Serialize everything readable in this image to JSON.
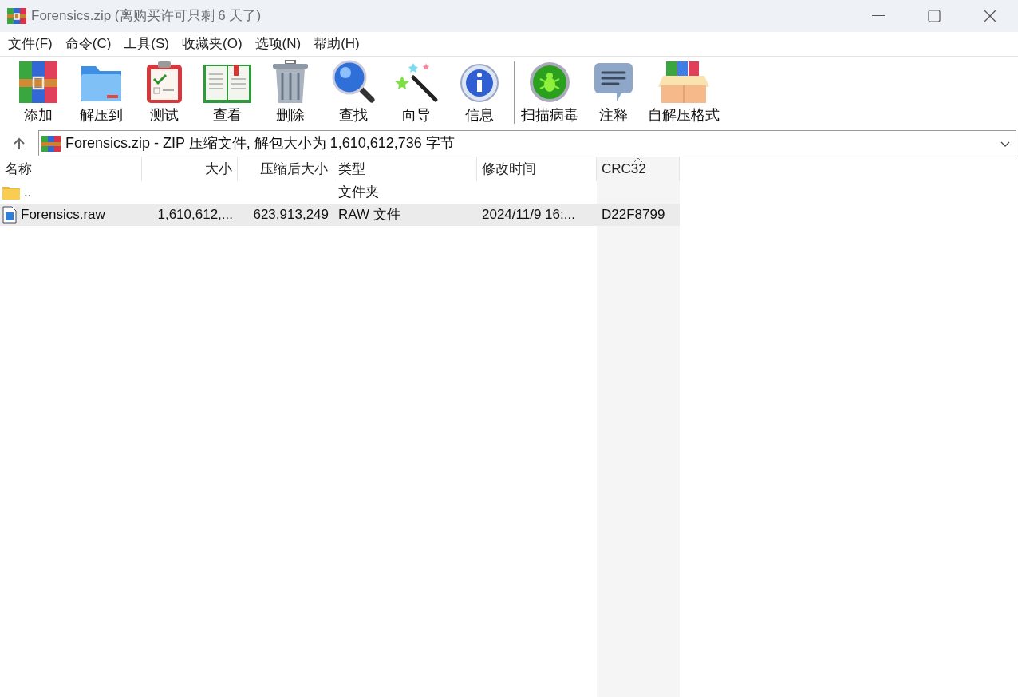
{
  "window": {
    "title": "Forensics.zip (离购买许可只剩 6 天了)"
  },
  "menu": [
    "文件(F)",
    "命令(C)",
    "工具(S)",
    "收藏夹(O)",
    "选项(N)",
    "帮助(H)"
  ],
  "toolbar": [
    {
      "kind": "add",
      "label": "添加"
    },
    {
      "kind": "extract",
      "label": "解压到"
    },
    {
      "kind": "test",
      "label": "测试"
    },
    {
      "kind": "view",
      "label": "查看"
    },
    {
      "kind": "delete",
      "label": "删除"
    },
    {
      "kind": "find",
      "label": "查找"
    },
    {
      "kind": "wizard",
      "label": "向导"
    },
    {
      "kind": "info",
      "label": "信息"
    },
    {
      "kind": "separator"
    },
    {
      "kind": "virus",
      "label": "扫描病毒"
    },
    {
      "kind": "comment",
      "label": "注释"
    },
    {
      "kind": "sfx",
      "label": "自解压格式"
    }
  ],
  "address": {
    "text": "Forensics.zip - ZIP 压缩文件, 解包大小为 1,610,612,736 字节"
  },
  "table": {
    "columns": [
      "名称",
      "大小",
      "压缩后大小",
      "类型",
      "修改时间",
      "CRC32"
    ],
    "rows": [
      {
        "kind": "folder",
        "selected": false,
        "cells": [
          "..",
          "",
          "",
          "文件夹",
          "",
          ""
        ]
      },
      {
        "kind": "file",
        "selected": true,
        "cells": [
          "Forensics.raw",
          "1,610,612,...",
          "623,913,249",
          "RAW 文件",
          "2024/11/9 16:...",
          "D22F8799"
        ]
      }
    ]
  }
}
